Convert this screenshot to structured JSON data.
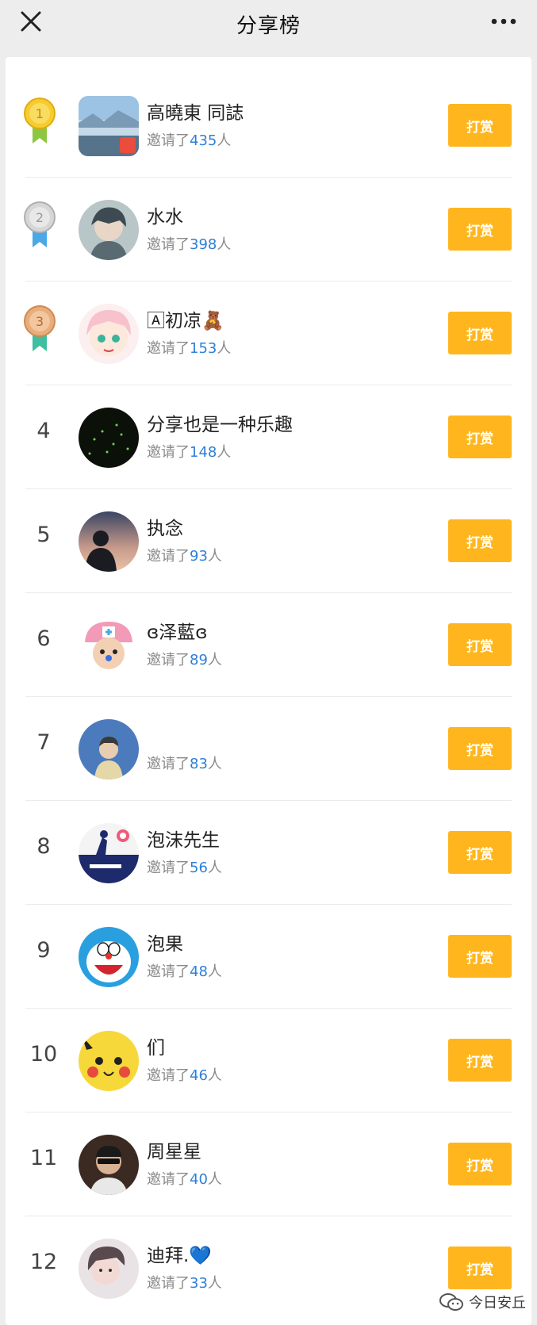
{
  "header": {
    "title": "分享榜",
    "close_icon": "close-icon",
    "more_icon": "more-icon"
  },
  "rows": [
    {
      "rank": "1",
      "name": "高曉東 同誌",
      "sub_prefix": "邀请了",
      "count": "435",
      "sub_suffix": "人",
      "button": "打赏",
      "medal": "gold"
    },
    {
      "rank": "2",
      "name": "水水",
      "sub_prefix": "邀请了",
      "count": "398",
      "sub_suffix": "人",
      "button": "打赏",
      "medal": "silver"
    },
    {
      "rank": "3",
      "name": "🄰初凉🧸",
      "sub_prefix": "邀请了",
      "count": "153",
      "sub_suffix": "人",
      "button": "打赏",
      "medal": "bronze"
    },
    {
      "rank": "4",
      "name": "分享也是一种乐趣",
      "sub_prefix": "邀请了",
      "count": "148",
      "sub_suffix": "人",
      "button": "打赏"
    },
    {
      "rank": "5",
      "name": "执念",
      "sub_prefix": "邀请了",
      "count": "93",
      "sub_suffix": "人",
      "button": "打赏"
    },
    {
      "rank": "6",
      "name": "ɞ泽藍ɞ",
      "sub_prefix": "邀请了",
      "count": "89",
      "sub_suffix": "人",
      "button": "打赏"
    },
    {
      "rank": "7",
      "name": "",
      "sub_prefix": "邀请了",
      "count": "83",
      "sub_suffix": "人",
      "button": "打赏"
    },
    {
      "rank": "8",
      "name": "泡沫先生",
      "sub_prefix": "邀请了",
      "count": "56",
      "sub_suffix": "人",
      "button": "打赏"
    },
    {
      "rank": "9",
      "name": "泡果",
      "sub_prefix": "邀请了",
      "count": "48",
      "sub_suffix": "人",
      "button": "打赏"
    },
    {
      "rank": "10",
      "name": "们",
      "sub_prefix": "邀请了",
      "count": "46",
      "sub_suffix": "人",
      "button": "打赏"
    },
    {
      "rank": "11",
      "name": "周星星",
      "sub_prefix": "邀请了",
      "count": "40",
      "sub_suffix": "人",
      "button": "打赏"
    },
    {
      "rank": "12",
      "name": "迪拜.💙",
      "sub_prefix": "邀请了",
      "count": "33",
      "sub_suffix": "人",
      "button": "打赏"
    }
  ],
  "watermark": {
    "text": "今日安丘",
    "icon": "wechat-official-account-icon"
  },
  "colors": {
    "button": "#ffb61e",
    "count": "#2e7fd9",
    "gold": "#f3c21b",
    "silver": "#c8c8c8",
    "bronze": "#e1a06a"
  }
}
